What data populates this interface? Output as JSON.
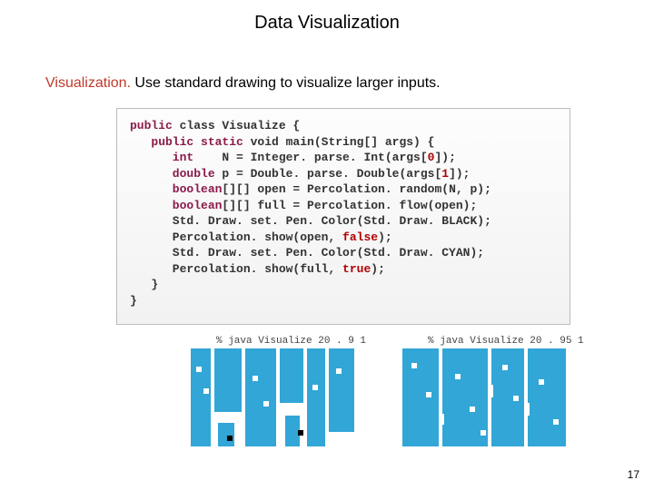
{
  "title": "Data Visualization",
  "heading_word": "Visualization.",
  "heading_rest": "  Use standard drawing to visualize larger inputs.",
  "code": {
    "l1a": "public",
    "l1b": " class Visualize {",
    "l2a": "   public",
    "l2b": " static",
    "l2c": " void main(String[] args) {",
    "l3a": "      int",
    "l3b": "    N = Integer. parse. Int(args[",
    "l3n": "0",
    "l3c": "]);",
    "l4a": "      double",
    "l4b": " p = Double. parse. Double(args[",
    "l4n": "1",
    "l4c": "]);",
    "l5a": "      boolean",
    "l5b": "[][] open = Percolation. random(N, p);",
    "l6a": "      boolean",
    "l6b": "[][] full = Percolation. flow(open);",
    "l7": "      Std. Draw. set. Pen. Color(Std. Draw. BLACK);",
    "l8a": "      Percolation. show(open, ",
    "l8b": "false",
    "l8c": ");",
    "l9": "      Std. Draw. set. Pen. Color(Std. Draw. CYAN);",
    "l10a": "      Percolation. show(full, ",
    "l10b": "true",
    "l10c": ");",
    "l11": "   }",
    "l12": "}"
  },
  "viz1": {
    "caption": "% java Visualize 20 . 9 1"
  },
  "viz2": {
    "caption": "% java Visualize 20 . 95 1"
  },
  "page_num": "17"
}
